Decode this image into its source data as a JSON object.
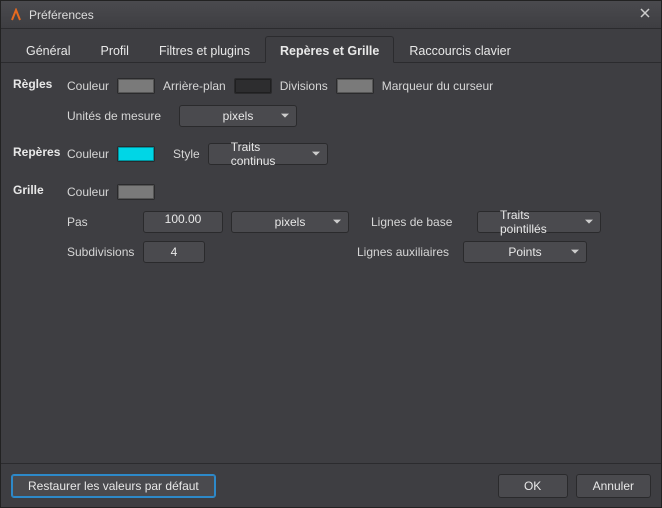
{
  "window": {
    "title": "Préférences"
  },
  "tabs": {
    "general": "Général",
    "profil": "Profil",
    "filters": "Filtres et plugins",
    "guides_grid": "Repères et Grille",
    "shortcuts": "Raccourcis clavier"
  },
  "rules": {
    "section": "Règles",
    "color_label": "Couleur",
    "color": "#7a7a7a",
    "background_label": "Arrière-plan",
    "background_color": "#2d2d2f",
    "divisions_label": "Divisions",
    "divisions_color": "#7a7a7a",
    "cursor_marker_label": "Marqueur du curseur",
    "units_label": "Unités de mesure",
    "units_value": "pixels"
  },
  "guides": {
    "section": "Repères",
    "color_label": "Couleur",
    "color": "#00d6e6",
    "style_label": "Style",
    "style_value": "Traits continus"
  },
  "grid": {
    "section": "Grille",
    "color_label": "Couleur",
    "color": "#7a7a7a",
    "step_label": "Pas",
    "step_value": "100.00",
    "step_unit": "pixels",
    "baselines_label": "Lignes de base",
    "baselines_value": "Traits pointillés",
    "subdivisions_label": "Subdivisions",
    "subdivisions_value": "4",
    "auxlines_label": "Lignes auxiliaires",
    "auxlines_value": "Points"
  },
  "footer": {
    "restore": "Restaurer les valeurs par défaut",
    "ok": "OK",
    "cancel": "Annuler"
  }
}
